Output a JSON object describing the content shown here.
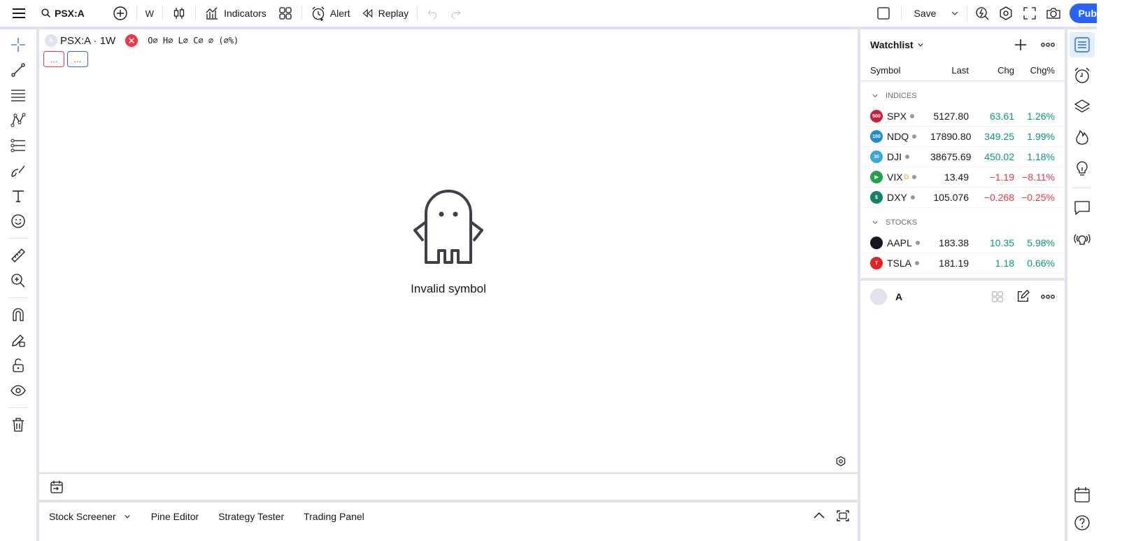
{
  "topbar": {
    "symbol": "PSX:A",
    "interval": "W",
    "indicators_label": "Indicators",
    "alert_label": "Alert",
    "replay_label": "Replay",
    "save_label": "Save",
    "publish_label": "Publish"
  },
  "legend": {
    "symbol_title": "PSX:A · 1W",
    "symbol_letter": "A",
    "ohlc": "O∅ H∅ L∅ C∅ ∅ (∅%)",
    "dots": "..."
  },
  "chart": {
    "message": "Invalid symbol"
  },
  "bottom_tabs": [
    {
      "label": "Stock Screener"
    },
    {
      "label": "Pine Editor"
    },
    {
      "label": "Strategy Tester"
    },
    {
      "label": "Trading Panel"
    }
  ],
  "watchlist": {
    "title": "Watchlist",
    "columns": {
      "symbol": "Symbol",
      "last": "Last",
      "chg": "Chg",
      "chgp": "Chg%"
    },
    "sections": [
      {
        "name": "INDICES",
        "rows": [
          {
            "logo": "500",
            "logo_color": "#c91f3c",
            "symbol": "SPX",
            "last": "5127.80",
            "chg": "63.61",
            "chgp": "1.26%",
            "dir": "pos"
          },
          {
            "logo": "100",
            "logo_color": "#1b8fcc",
            "symbol": "NDQ",
            "last": "17890.80",
            "chg": "349.25",
            "chgp": "1.99%",
            "dir": "pos"
          },
          {
            "logo": "30",
            "logo_color": "#35a7dd",
            "symbol": "DJI",
            "last": "38675.69",
            "chg": "450.02",
            "chgp": "1.18%",
            "dir": "pos"
          },
          {
            "logo": "▶",
            "logo_color": "#22a04a",
            "symbol": "VIX",
            "badge": "D",
            "last": "13.49",
            "chg": "−1.19",
            "chgp": "−8.11%",
            "dir": "neg"
          },
          {
            "logo": "$",
            "logo_color": "#138266",
            "symbol": "DXY",
            "last": "105.076",
            "chg": "−0.268",
            "chgp": "−0.25%",
            "dir": "neg"
          }
        ]
      },
      {
        "name": "STOCKS",
        "rows": [
          {
            "logo": "",
            "logo_color": "#131722",
            "symbol": "AAPL",
            "last": "183.38",
            "chg": "10.35",
            "chgp": "5.98%",
            "dir": "pos"
          },
          {
            "logo": "T",
            "logo_color": "#e82127",
            "symbol": "TSLA",
            "last": "181.19",
            "chg": "1.18",
            "chgp": "0.66%",
            "dir": "pos"
          }
        ]
      }
    ]
  },
  "details": {
    "name": "A"
  },
  "colors": {
    "accent": "#2962ff",
    "positive": "#089981",
    "negative": "#f23645"
  }
}
